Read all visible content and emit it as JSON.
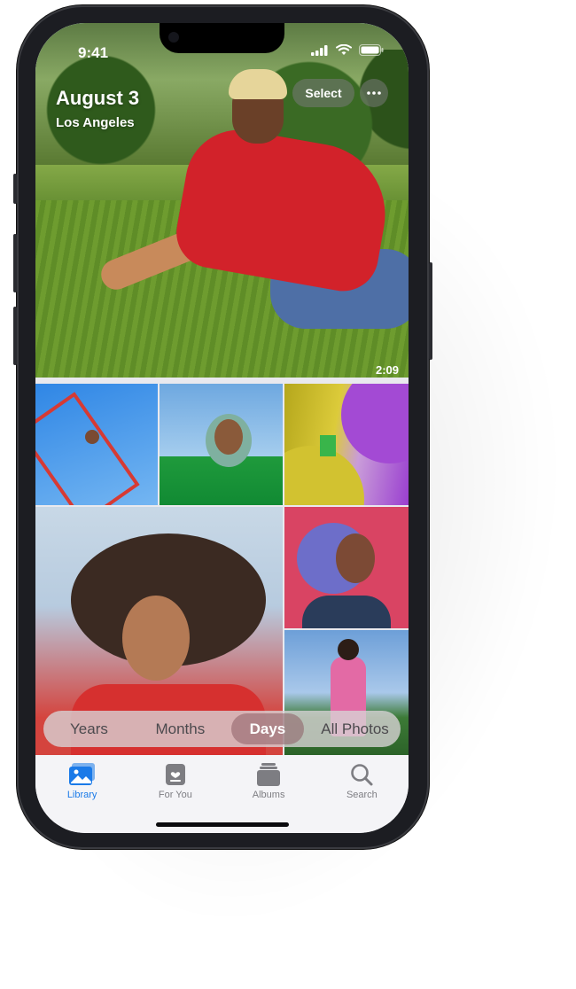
{
  "status_bar": {
    "time": "9:41"
  },
  "hero": {
    "title": "August 3",
    "location": "Los Angeles",
    "duration": "2:09",
    "select_label": "Select",
    "more_icon": "ellipsis-icon"
  },
  "segmented": {
    "items": [
      "Years",
      "Months",
      "Days",
      "All Photos"
    ],
    "selected": "Days"
  },
  "tabbar": {
    "items": [
      {
        "label": "Library",
        "icon": "photo-library-icon",
        "active": true
      },
      {
        "label": "For You",
        "icon": "heart-note-icon",
        "active": false
      },
      {
        "label": "Albums",
        "icon": "albums-stack-icon",
        "active": false
      },
      {
        "label": "Search",
        "icon": "search-icon",
        "active": false
      }
    ]
  },
  "colors": {
    "accent": "#1a7ae8",
    "phone_frame": "#1c1d22"
  }
}
